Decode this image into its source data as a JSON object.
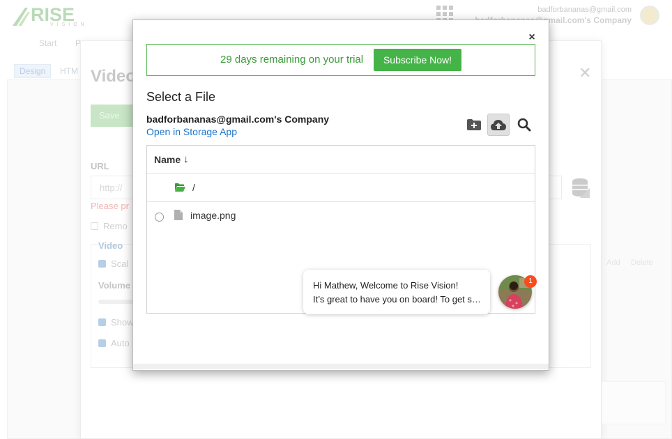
{
  "header": {
    "logo_text": "RISE",
    "logo_subtext": "VISION",
    "account_email": "badforbananas@gmail.com",
    "account_company": "badforbananas@gmail.com's Company"
  },
  "nav": {
    "start": "Start",
    "second": "P"
  },
  "editor_tabs": {
    "design": "Design",
    "html": "HTM"
  },
  "video_settings": {
    "title": "Video",
    "save": "Save",
    "url_label": "URL",
    "url_placeholder": "http://",
    "error_text": "Please pr",
    "remove_label": "Remo",
    "video_section": "Video",
    "scale_label": "Scal",
    "volume_label": "Volume",
    "show_label": "Show",
    "auto_label": "Auto",
    "add": "Add",
    "delete": "Delete"
  },
  "dialog": {
    "close": "×",
    "trial_text": "29 days remaining on your trial",
    "subscribe": "Subscribe Now!",
    "title": "Select a File",
    "company": "badforbananas@gmail.com's Company",
    "open_link": "Open in Storage App",
    "list": {
      "column_name": "Name",
      "sort_indicator": "↓",
      "rows": [
        {
          "type": "folder",
          "label": "/"
        },
        {
          "type": "file",
          "label": "image.png"
        }
      ]
    }
  },
  "chat": {
    "line1": "Hi Mathew, Welcome to Rise Vision!",
    "line2": "It’s great to have you on board! To get started",
    "badge": "1"
  },
  "colors": {
    "accent_green": "#45b448",
    "link_blue": "#1a73c7",
    "badge_orange": "#fa4b1c"
  }
}
